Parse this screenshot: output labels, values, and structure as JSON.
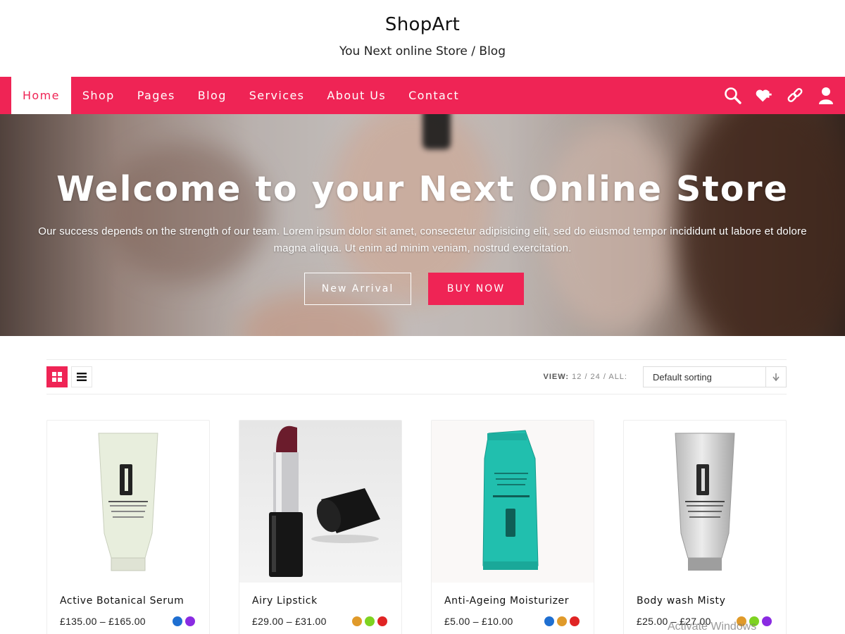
{
  "site": {
    "title": "ShopArt",
    "tagline": "You Next online Store / Blog"
  },
  "nav": {
    "items": [
      "Home",
      "Shop",
      "Pages",
      "Blog",
      "Services",
      "About Us",
      "Contact"
    ],
    "active": "Home",
    "icons": [
      "search-icon",
      "wishlist-heart-icon",
      "link-icon",
      "user-icon"
    ]
  },
  "hero": {
    "title": "Welcome to your Next Online Store",
    "text": "Our success depends on the strength of our team. Lorem ipsum dolor sit amet, consectetur adipisicing elit, sed do eiusmod tempor incididunt ut labore et dolore magna aliqua. Ut enim ad minim veniam, nostrud exercitation.",
    "button_secondary": "New Arrival",
    "button_primary": "BUY NOW"
  },
  "toolbar": {
    "view_label": "VIEW:",
    "view_counts": "12 / 24 / ALL:",
    "sort_selected": "Default sorting",
    "layout_active": "grid"
  },
  "products": [
    {
      "name": "Active Botanical Serum",
      "price": "£135.00 – £165.00",
      "swatches": [
        "#1f6fd1",
        "#8a2be2"
      ]
    },
    {
      "name": "Airy Lipstick",
      "price": "£29.00 – £31.00",
      "swatches": [
        "#e09a2a",
        "#7ed321",
        "#e02424"
      ]
    },
    {
      "name": "Anti-Ageing Moisturizer",
      "price": "£5.00 – £10.00",
      "swatches": [
        "#1f6fd1",
        "#e09a2a",
        "#e02424"
      ]
    },
    {
      "name": "Body wash Misty",
      "price": "£25.00 – £27.00",
      "swatches": [
        "#e09a2a",
        "#7ed321",
        "#8a2be2"
      ]
    }
  ],
  "colors": {
    "accent": "#ef2455"
  },
  "os_watermark": "Activate Windows"
}
